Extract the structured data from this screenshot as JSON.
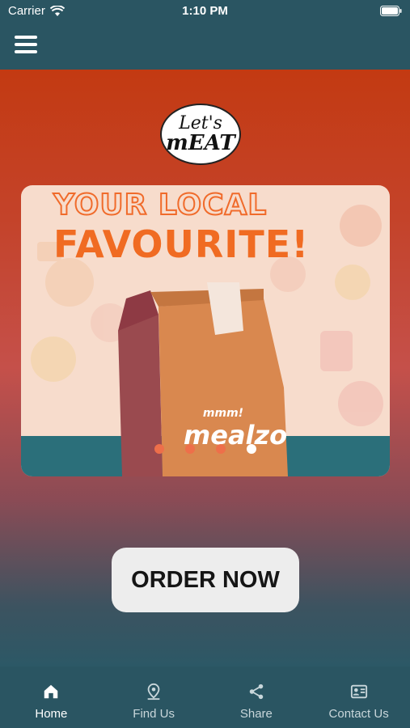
{
  "status": {
    "carrier": "Carrier",
    "time": "1:10 PM"
  },
  "header": {
    "menu_icon": "hamburger-menu-icon"
  },
  "logo": {
    "line1": "Let's",
    "line2": "mEAT"
  },
  "banner": {
    "headline_top": "YOUR LOCAL",
    "headline_bottom": "FAVOURITE!",
    "bag_tag": "mmm!",
    "bag_brand": "mealzo",
    "slides": 4,
    "active_slide": 4
  },
  "cta": {
    "order_label": "ORDER NOW"
  },
  "tabs": [
    {
      "label": "Home",
      "icon": "home-icon",
      "active": true
    },
    {
      "label": "Find Us",
      "icon": "location-pin-icon",
      "active": false
    },
    {
      "label": "Share",
      "icon": "share-icon",
      "active": false
    },
    {
      "label": "Contact Us",
      "icon": "contact-card-icon",
      "active": false
    }
  ],
  "colors": {
    "header": "#2a5562",
    "accent_orange": "#f06b22",
    "teal": "#2b6f7a"
  }
}
